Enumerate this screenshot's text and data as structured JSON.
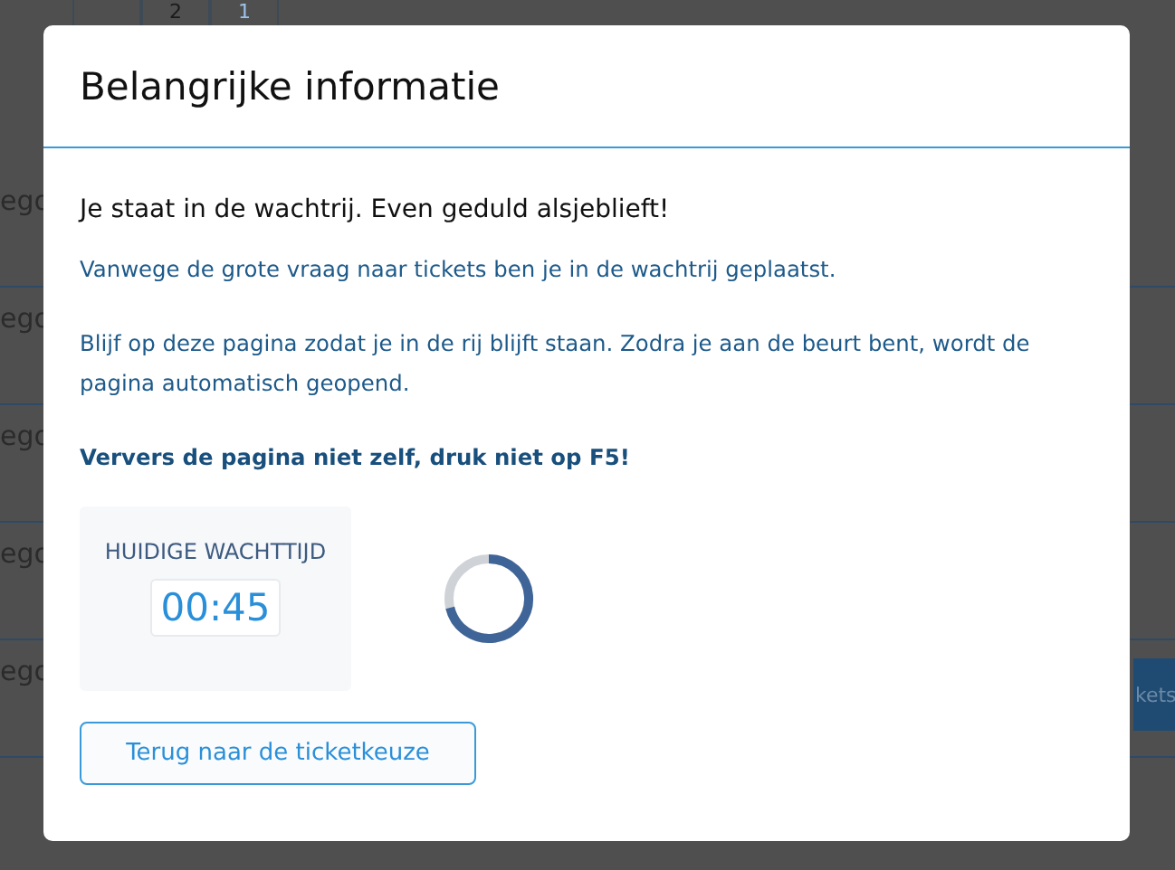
{
  "background": {
    "pagination": [
      "2",
      "1"
    ],
    "rows": [
      "ego",
      "ego",
      "ego",
      "ego",
      "ego"
    ],
    "side_button": "kets"
  },
  "modal": {
    "title": "Belangrijke informatie",
    "intro": "Je staat in de wachtrij. Even geduld alsjeblieft!",
    "paragraphs": [
      {
        "kind": "plain",
        "text": "Vanwege de grote vraag naar tickets ben je in de wachtrij geplaatst."
      },
      {
        "kind": "plain",
        "text": "Blijf op deze pagina zodat je in de rij blijft staan. Zodra je aan de beurt bent, wordt de pagina automatisch geopend."
      },
      {
        "kind": "warning",
        "text": "Ververs de pagina niet zelf, druk niet op F5!"
      }
    ],
    "wait": {
      "label": "HUIDIGE WACHTTIJD",
      "time": "00:45"
    },
    "back_button": "Terug naar de ticketkeuze"
  }
}
